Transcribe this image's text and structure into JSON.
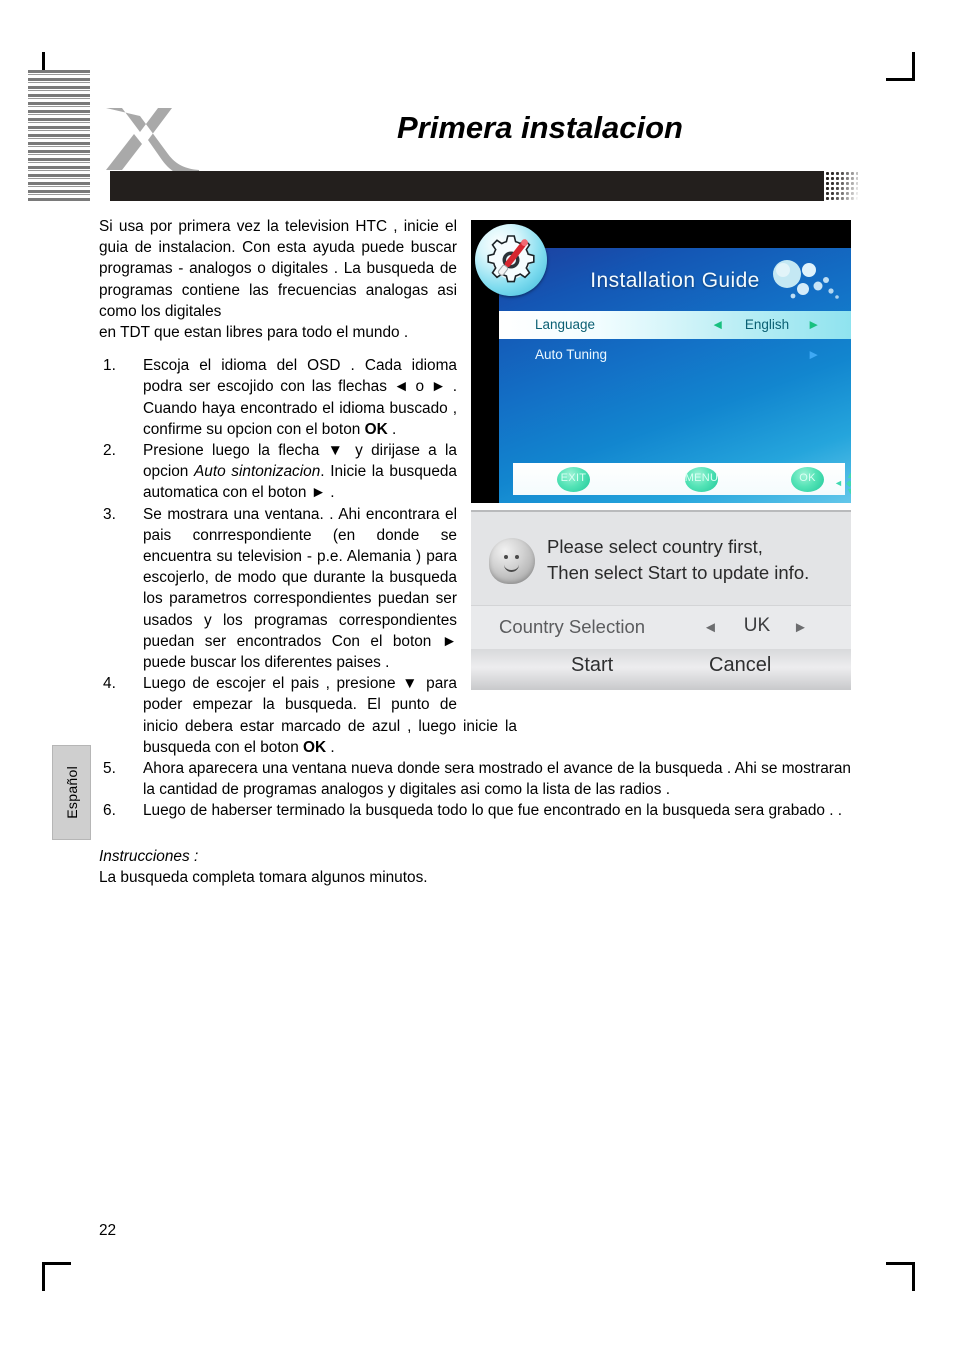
{
  "page": {
    "title": "Primera instalacion",
    "number": "22",
    "language_tab": "Español"
  },
  "intro": {
    "line1": "Si usa por primera vez la television HTC , inicie el guia de instalacion. Con esta ayuda puede buscar programas - analogos o digitales . La busqueda de programas contiene las frecuencias analogas asi como los digitales",
    "line2": "en TDT que estan libres para todo el mundo ."
  },
  "steps": [
    {
      "num": "1.",
      "parts_pre": "Escoja el idioma del OSD . Cada idioma podra ser escojido con las flechas  ◄ o ► . Cuando haya encontrado el idioma buscado , confirme su opcion con el boton ",
      "bold": "OK",
      "parts_post": " ."
    },
    {
      "num": "2.",
      "parts_pre": "Presione luego la flecha ▼  y dirijase a la opcion ",
      "italic": "Auto sintonizacion",
      "parts_post": ". Inicie la busqueda automatica con el boton  ► ."
    },
    {
      "num": "3.",
      "text": "Se mostrara una ventana.  . Ahi encontrara el pais conrrespondiente (en donde se encuentra su television - p.e. Alemania ) para escojerlo, de modo que durante la busqueda los parametros correspondientes puedan ser usados y los programas correspondientes puedan ser encontrados  Con el boton ► puede buscar los diferentes paises ."
    },
    {
      "num": "4.",
      "parts_pre": "Luego de escojer el pais , presione ▼ para poder empezar la busqueda. El punto de inicio debera estar marcado de azul , luego inicie la busqueda con el boton ",
      "bold": "OK",
      "parts_post": " ."
    },
    {
      "num": "5.",
      "text": "Ahora aparecera una ventana nueva donde sera mostrado el avance de la busqueda  . Ahi se mostraran la cantidad de programas analogos y digitales asi como la lista de las radios ."
    },
    {
      "num": "6.",
      "text": "Luego de haberser terminado la busqueda  todo lo que fue encontrado en la busqueda sera grabado . ."
    }
  ],
  "instructions": {
    "title": "Instrucciones :",
    "body": "La busqueda completa tomara algunos minutos."
  },
  "tv_osd": {
    "title": "Installation Guide",
    "rows": [
      {
        "label": "Language",
        "left_arrow": "◄",
        "value": "English",
        "right_arrow": "►"
      },
      {
        "label": "Auto Tuning",
        "left_arrow": "",
        "value": "",
        "right_arrow": "►"
      }
    ],
    "footer": {
      "exit": "EXIT",
      "menu": "MENU",
      "ok": "OK",
      "dpad_up": "▲",
      "dpad_down": "▼",
      "dpad_left": "◄",
      "dpad_right": "►",
      "dpad_center": "◆"
    },
    "accent_selected_bg": "#c3f0f6",
    "accent_button": "#1fc79a"
  },
  "tv_dialog": {
    "message_line1": "Please select country first,",
    "message_line2": "Then select Start to update info.",
    "selector_label": "Country Selection",
    "selector_left_arrow": "◄",
    "selector_value": "UK",
    "selector_right_arrow": "►",
    "start_label": "Start",
    "cancel_label": "Cancel"
  }
}
